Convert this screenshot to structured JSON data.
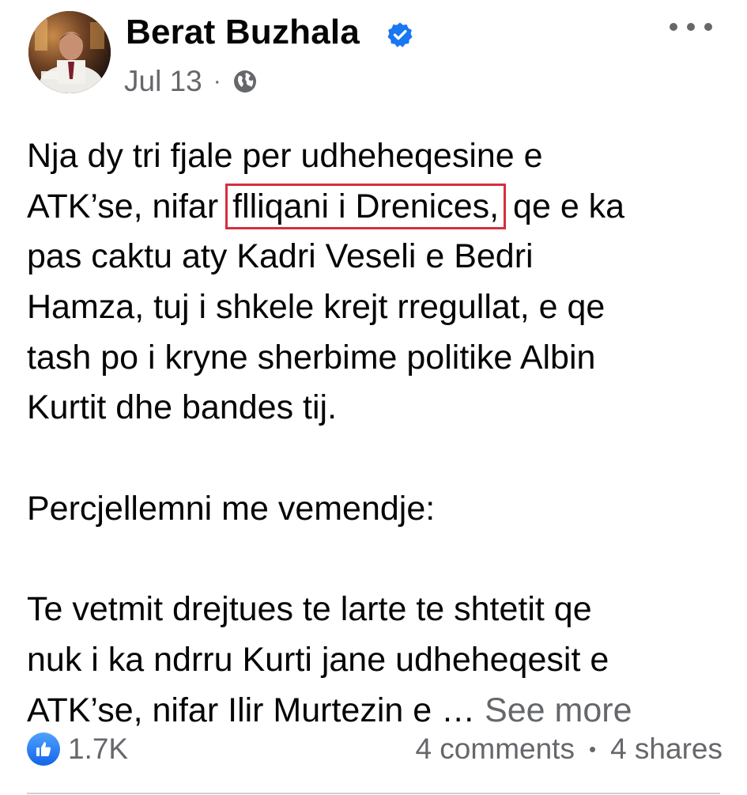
{
  "post": {
    "author": {
      "name": "Berat Buzhala",
      "verified": true
    },
    "timestamp": "Jul 13",
    "meta_separator": "·",
    "audience_icon": "globe-icon",
    "more_icon": "more-options-icon",
    "text": {
      "p1": {
        "l1": "Nja dy tri fjale per udheheqesine e",
        "l2_before": "ATK’se, nifar ",
        "l2_highlight": "flliqani i Drenices,",
        "l2_after": " qe e ka",
        "l3": "pas caktu aty Kadri Veseli e Bedri",
        "l4": "Hamza, tuj i shkele krejt rregullat, e qe",
        "l5": "tash po i kryne sherbime politike Albin",
        "l6": "Kurtit dhe bandes tij."
      },
      "p2": "Percjellemni me vemendje:",
      "p3": {
        "l1": "Te vetmit drejtues te larte te shtetit qe",
        "l2": "nuk i ka ndrru Kurti jane udheheqesit e",
        "l3": "ATK’se, nifar Ilir Murtezin e … "
      },
      "see_more": "See more"
    },
    "footer": {
      "reaction_icon": "like-icon",
      "reactions": "1.7K",
      "comments": "4 comments",
      "separator": "•",
      "shares": "4 shares"
    },
    "colors": {
      "text": "#050505",
      "secondary": "#65676b",
      "verified": "#1877f2",
      "highlight_box": "#d3303f"
    }
  }
}
